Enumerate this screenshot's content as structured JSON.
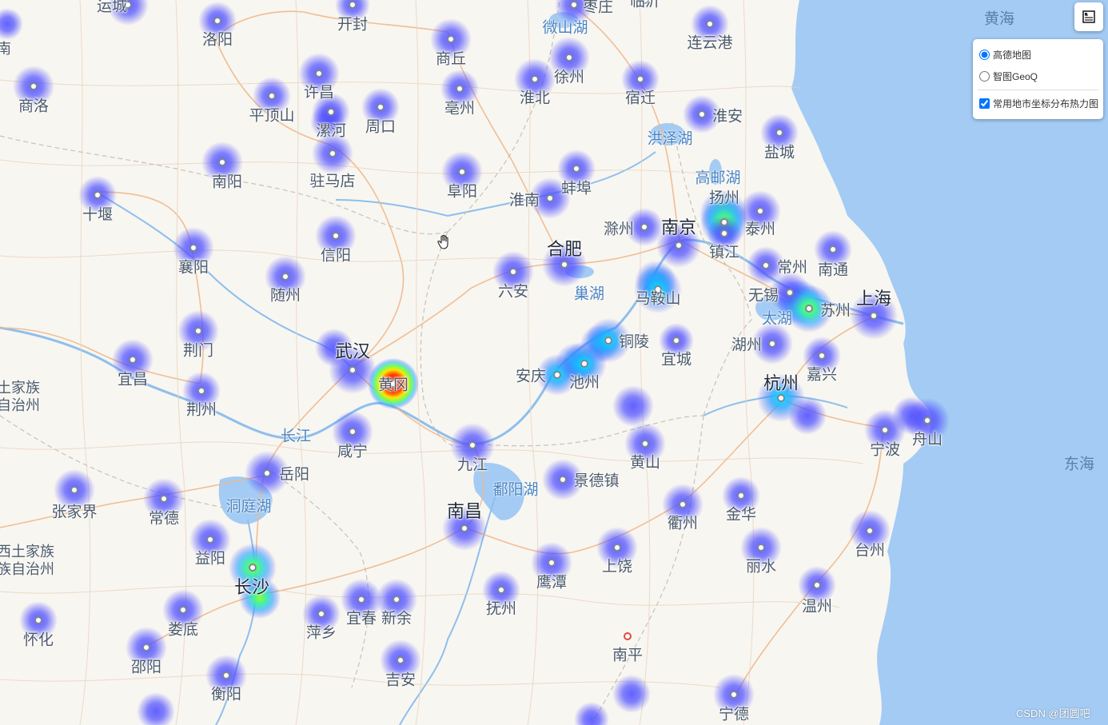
{
  "map": {
    "colors": {
      "land": "#f8f6f1",
      "sea": "#a3cbf4",
      "lake": "#a3cbf4",
      "river": "#8ebfec",
      "road_major": "#f0b889",
      "road_minor": "#e8d2bb",
      "boundary": "#c9c1b7"
    },
    "seas": [
      {
        "name": "黄海"
      },
      {
        "name": "东海"
      }
    ],
    "water_labels": [
      {
        "name": "微山湖"
      },
      {
        "name": "洪泽湖"
      },
      {
        "name": "高邮湖"
      },
      {
        "name": "巢湖"
      },
      {
        "name": "太湖"
      },
      {
        "name": "长江"
      },
      {
        "name": "洞庭湖"
      },
      {
        "name": "鄱阳湖"
      }
    ],
    "cities": [
      {
        "name": "运城"
      },
      {
        "name": "洛阳"
      },
      {
        "name": "开封"
      },
      {
        "name": "枣庄"
      },
      {
        "name": "临沂"
      },
      {
        "name": "连云港"
      },
      {
        "name": "商洛"
      },
      {
        "name": "平顶山"
      },
      {
        "name": "许昌"
      },
      {
        "name": "漯河"
      },
      {
        "name": "周口"
      },
      {
        "name": "商丘"
      },
      {
        "name": "亳州"
      },
      {
        "name": "淮北"
      },
      {
        "name": "徐州"
      },
      {
        "name": "宿迁"
      },
      {
        "name": "淮安"
      },
      {
        "name": "盐城"
      },
      {
        "name": "南阳"
      },
      {
        "name": "驻马店"
      },
      {
        "name": "阜阳"
      },
      {
        "name": "淮南"
      },
      {
        "name": "蚌埠"
      },
      {
        "name": "十堰"
      },
      {
        "name": "扬州"
      },
      {
        "name": "泰州"
      },
      {
        "name": "滁州"
      },
      {
        "name": "南京"
      },
      {
        "name": "镇江"
      },
      {
        "name": "襄阳"
      },
      {
        "name": "信阳"
      },
      {
        "name": "合肥"
      },
      {
        "name": "六安"
      },
      {
        "name": "常州"
      },
      {
        "name": "南通"
      },
      {
        "name": "随州"
      },
      {
        "name": "马鞍山"
      },
      {
        "name": "无锡"
      },
      {
        "name": "苏州"
      },
      {
        "name": "上海"
      },
      {
        "name": "荆门"
      },
      {
        "name": "铜陵"
      },
      {
        "name": "湖州"
      },
      {
        "name": "宜城"
      },
      {
        "name": "武汉"
      },
      {
        "name": "宜昌"
      },
      {
        "name": "嘉兴"
      },
      {
        "name": "安庆"
      },
      {
        "name": "池州"
      },
      {
        "name": "杭州"
      },
      {
        "name": "荆州"
      },
      {
        "name": "黄冈"
      },
      {
        "name": "长江"
      },
      {
        "name": "咸宁"
      },
      {
        "name": "宁波"
      },
      {
        "name": "舟山"
      },
      {
        "name": "九江"
      },
      {
        "name": "黄山"
      },
      {
        "name": "岳阳"
      },
      {
        "name": "张家界"
      },
      {
        "name": "常德"
      },
      {
        "name": "景德镇"
      },
      {
        "name": "衢州"
      },
      {
        "name": "金华"
      },
      {
        "name": "南昌"
      },
      {
        "name": "益阳"
      },
      {
        "name": "台州"
      },
      {
        "name": "丽水"
      },
      {
        "name": "鹰潭"
      },
      {
        "name": "上饶"
      },
      {
        "name": "长沙"
      },
      {
        "name": "温州"
      },
      {
        "name": "抚州"
      },
      {
        "name": "娄底"
      },
      {
        "name": "宜春"
      },
      {
        "name": "新余"
      },
      {
        "name": "怀化"
      },
      {
        "name": "萍乡"
      },
      {
        "name": "南平"
      },
      {
        "name": "邵阳"
      },
      {
        "name": "吉安"
      },
      {
        "name": "衡阳"
      },
      {
        "name": "宁德"
      }
    ],
    "partial_labels": [
      {
        "name": "南"
      },
      {
        "name": "土家族\n自治州"
      },
      {
        "name": "西土家族\n族自治州"
      }
    ],
    "heat_colors": [
      "#3a3aff",
      "#00e5ff",
      "#7cff3a",
      "#ffe800",
      "#ff2a00"
    ]
  },
  "controls": {
    "layer_button_icon": "layers-icon",
    "base_layers": [
      {
        "label": "高德地图",
        "checked": true
      },
      {
        "label": "智图GeoQ",
        "checked": false
      }
    ],
    "overlays": [
      {
        "label": "常用地市坐标分布热力图",
        "checked": true
      }
    ]
  },
  "credit": "CSDN @团圆吧"
}
